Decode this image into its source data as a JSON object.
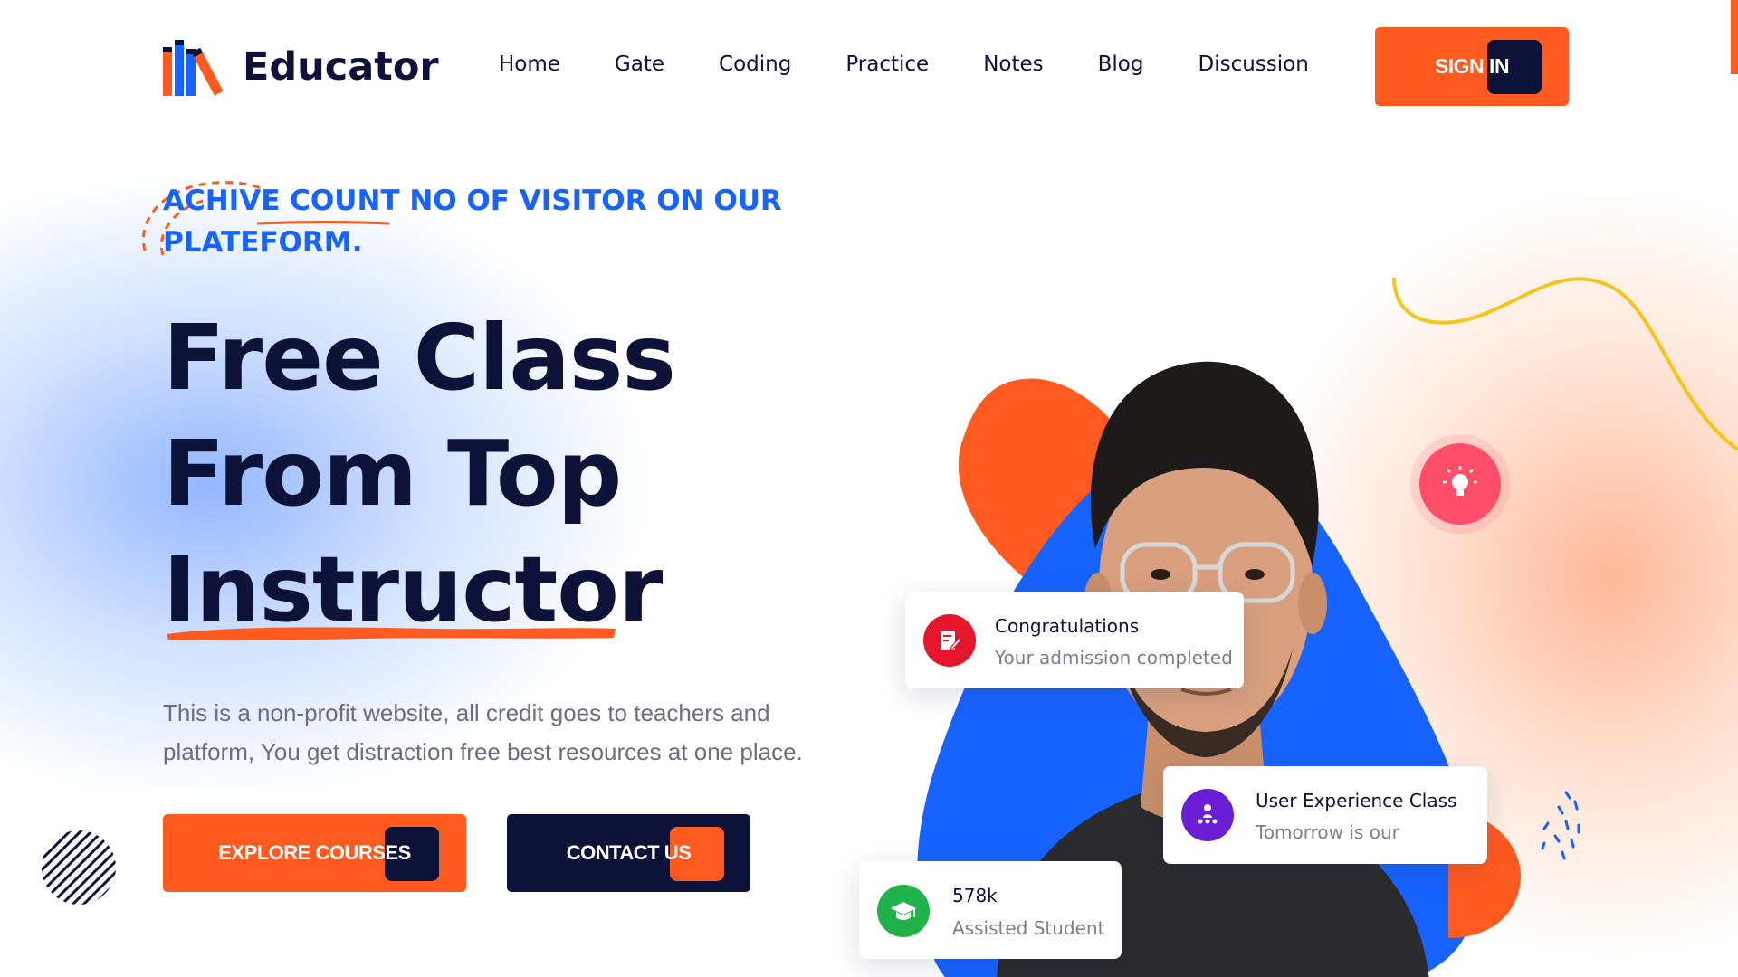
{
  "brand": {
    "name": "Educator",
    "accent": "#ff5a1f",
    "navy": "#0d1238",
    "blue": "#1763ff"
  },
  "nav": {
    "items": [
      "Home",
      "Gate",
      "Coding",
      "Practice",
      "Notes",
      "Blog",
      "Discussion"
    ]
  },
  "header": {
    "signin_label": "SIGN IN"
  },
  "hero": {
    "tagline": "ACHIVE COUNT NO OF VISITOR ON OUR PLATEFORM.",
    "headline_line1": "Free Class",
    "headline_line2": "From Top",
    "headline_line3": "Instructor",
    "description": "This is a non-profit website, all credit goes to teachers and platform, You get distraction free best resources at one place.",
    "explore_label": "EXPLORE COURSES",
    "contact_label": "CONTACT US"
  },
  "cards": {
    "congrats": {
      "title": "Congratulations",
      "subtitle": "Your admission completed",
      "icon": "document-edit-icon"
    },
    "ux_class": {
      "title": "User Experience Class",
      "subtitle": "Tomorrow is our",
      "icon": "class-people-icon"
    },
    "students": {
      "title": "578k",
      "subtitle": "Assisted Student",
      "icon": "graduation-cap-icon"
    }
  }
}
